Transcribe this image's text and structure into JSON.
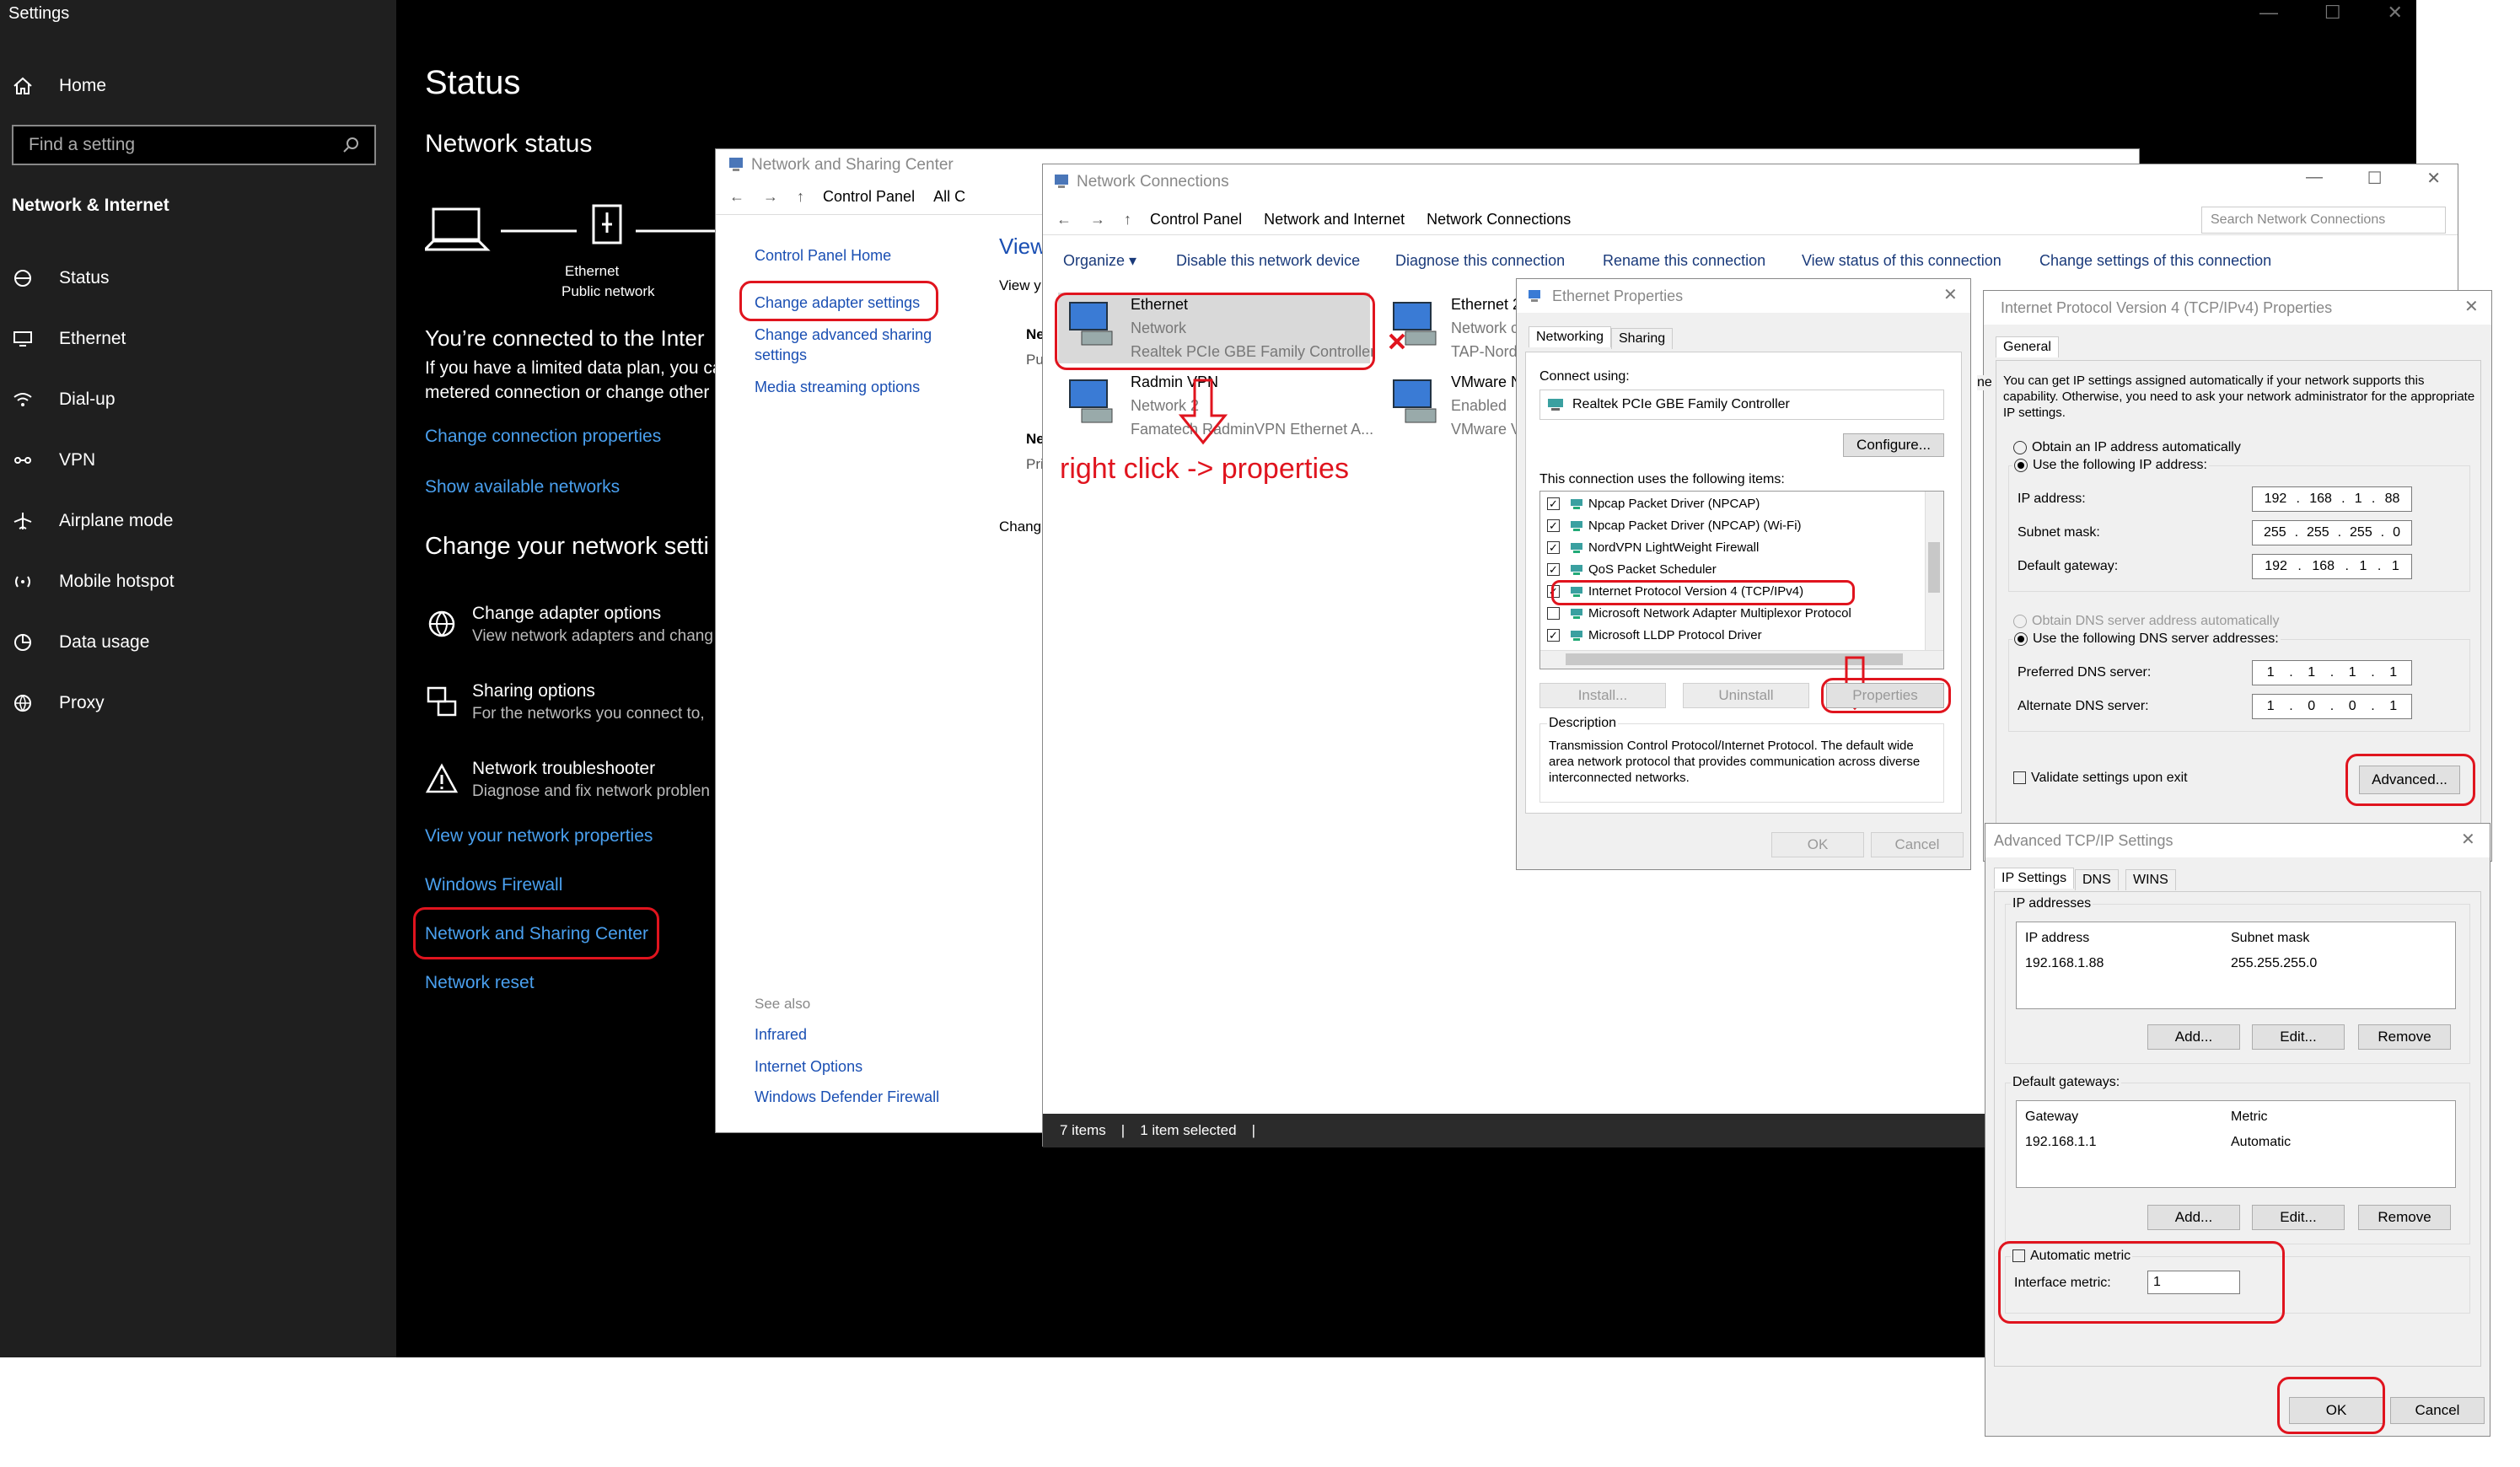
{
  "settings": {
    "window_title": "Settings",
    "home": "Home",
    "search_placeholder": "Find a setting",
    "category": "Network & Internet",
    "nav": [
      {
        "label": "Status",
        "icon": "status-icon"
      },
      {
        "label": "Ethernet",
        "icon": "ethernet-icon"
      },
      {
        "label": "Dial-up",
        "icon": "dialup-icon"
      },
      {
        "label": "VPN",
        "icon": "vpn-icon"
      },
      {
        "label": "Airplane mode",
        "icon": "airplane-icon"
      },
      {
        "label": "Mobile hotspot",
        "icon": "hotspot-icon"
      },
      {
        "label": "Data usage",
        "icon": "data-usage-icon"
      },
      {
        "label": "Proxy",
        "icon": "proxy-icon"
      }
    ],
    "page_title": "Status",
    "network_status": "Network status",
    "net_device_label": "Ethernet",
    "net_profile": "Public network",
    "connected_text": "You’re connected to the Inter",
    "limited_line1": "If you have a limited data plan, you ca",
    "limited_line2": "metered connection or change other",
    "change_props": "Change connection properties",
    "show_networks": "Show available networks",
    "change_settings_title": "Change your network setti",
    "options": [
      {
        "title": "Change adapter options",
        "sub": "View network adapters and chang",
        "icon": "adapter-options-icon"
      },
      {
        "title": "Sharing options",
        "sub": "For the networks you connect to,",
        "icon": "sharing-options-icon"
      },
      {
        "title": "Network troubleshooter",
        "sub": "Diagnose and fix network problen",
        "icon": "troubleshooter-icon"
      }
    ],
    "view_props": "View your network properties",
    "firewall": "Windows Firewall",
    "nsc": "Network and Sharing Center",
    "reset": "Network reset"
  },
  "nsc": {
    "title": "Network and Sharing Center",
    "crumb1": "Control Panel",
    "crumb2": "All C",
    "home": "Control Panel Home",
    "adapter": "Change adapter settings",
    "advanced_l1": "Change advanced sharing",
    "advanced_l2": "settings",
    "media": "Media streaming options",
    "view": "View",
    "view_y": "View y",
    "frag_ne": "Ne",
    "frag_pu": "Pu",
    "frag_ne2": "Ne",
    "frag_pri": "Pri",
    "frag_chang": "Chang",
    "see_also": "See also",
    "infrared": "Infrared",
    "internet_options": "Internet Options",
    "defender": "Windows Defender Firewall"
  },
  "nc": {
    "title": "Network Connections",
    "crumbs": [
      "Control Panel",
      "Network and Internet",
      "Network Connections"
    ],
    "search_placeholder": "Search Network Connections",
    "toolbar": [
      "Organize ▾",
      "Disable this network device",
      "Diagnose this connection",
      "Rename this connection",
      "View status of this connection",
      "Change settings of this connection"
    ],
    "adapters": [
      {
        "name": "Ethernet",
        "status": "Network",
        "device": "Realtek PCIe GBE Family Controller"
      },
      {
        "name": "Ethernet 2",
        "status": "Network c",
        "device": "TAP-Nord"
      },
      {
        "name": "Radmin VPN",
        "status": "Network 2",
        "device": "Famatech RadminVPN Ethernet A..."
      },
      {
        "name": "VMware N",
        "status": "Enabled",
        "device": "VMware V"
      }
    ],
    "status_items": "7 items",
    "status_selected": "1 item selected",
    "annotation": "right click -> properties"
  },
  "eth_props": {
    "title": "Ethernet Properties",
    "tabs": [
      "Networking",
      "Sharing"
    ],
    "connect_using": "Connect using:",
    "adapter": "Realtek PCIe GBE Family Controller",
    "configure": "Configure...",
    "items_label": "This connection uses the following items:",
    "items": [
      {
        "label": "Npcap Packet Driver (NPCAP)",
        "checked": true
      },
      {
        "label": "Npcap Packet Driver (NPCAP) (Wi-Fi)",
        "checked": true
      },
      {
        "label": "NordVPN LightWeight Firewall",
        "checked": true
      },
      {
        "label": "QoS Packet Scheduler",
        "checked": true
      },
      {
        "label": "Internet Protocol Version 4 (TCP/IPv4)",
        "checked": true
      },
      {
        "label": "Microsoft Network Adapter Multiplexor Protocol",
        "checked": false
      },
      {
        "label": "Microsoft LLDP Protocol Driver",
        "checked": true
      }
    ],
    "install": "Install...",
    "uninstall": "Uninstall",
    "properties": "Properties",
    "description_label": "Description",
    "description": "Transmission Control Protocol/Internet Protocol. The default wide area network protocol that provides communication across diverse interconnected networks.",
    "ok": "OK",
    "cancel": "Cancel"
  },
  "ipv4": {
    "title": "Internet Protocol Version 4 (TCP/IPv4) Properties",
    "tab": "General",
    "intro": "You can get IP settings assigned automatically if your network supports this capability. Otherwise, you need to ask your network administrator for the appropriate IP settings.",
    "obtain_auto": "Obtain an IP address automatically",
    "use_following": "Use the following IP address:",
    "ip_label": "IP address:",
    "ip": [
      "192",
      "168",
      "1",
      "88"
    ],
    "mask_label": "Subnet mask:",
    "mask": [
      "255",
      "255",
      "255",
      "0"
    ],
    "gw_label": "Default gateway:",
    "gw": [
      "192",
      "168",
      "1",
      "1"
    ],
    "dns_auto": "Obtain DNS server address automatically",
    "dns_use": "Use the following DNS server addresses:",
    "pref_label": "Preferred DNS server:",
    "pref": [
      "1",
      "1",
      "1",
      "1"
    ],
    "alt_label": "Alternate DNS server:",
    "alt": [
      "1",
      "0",
      "0",
      "1"
    ],
    "frag_ne": "ne",
    "validate": "Validate settings upon exit",
    "advanced": "Advanced..."
  },
  "adv": {
    "title": "Advanced TCP/IP Settings",
    "tabs": [
      "IP Settings",
      "DNS",
      "WINS"
    ],
    "ip_group": "IP addresses",
    "col_ip": "IP address",
    "col_mask": "Subnet mask",
    "ip_val": "192.168.1.88",
    "mask_val": "255.255.255.0",
    "add": "Add...",
    "edit": "Edit...",
    "remove": "Remove",
    "gw_group": "Default gateways:",
    "col_gw": "Gateway",
    "col_metric": "Metric",
    "gw_val": "192.168.1.1",
    "metric_val": "Automatic",
    "auto_metric": "Automatic metric",
    "iface_metric": "Interface metric:",
    "iface_val": "1",
    "ok": "OK",
    "cancel": "Cancel"
  },
  "colors": {
    "annotation": "#e0141e",
    "link_dark": "#4aa0ef",
    "link_light": "#1a4fb3"
  }
}
